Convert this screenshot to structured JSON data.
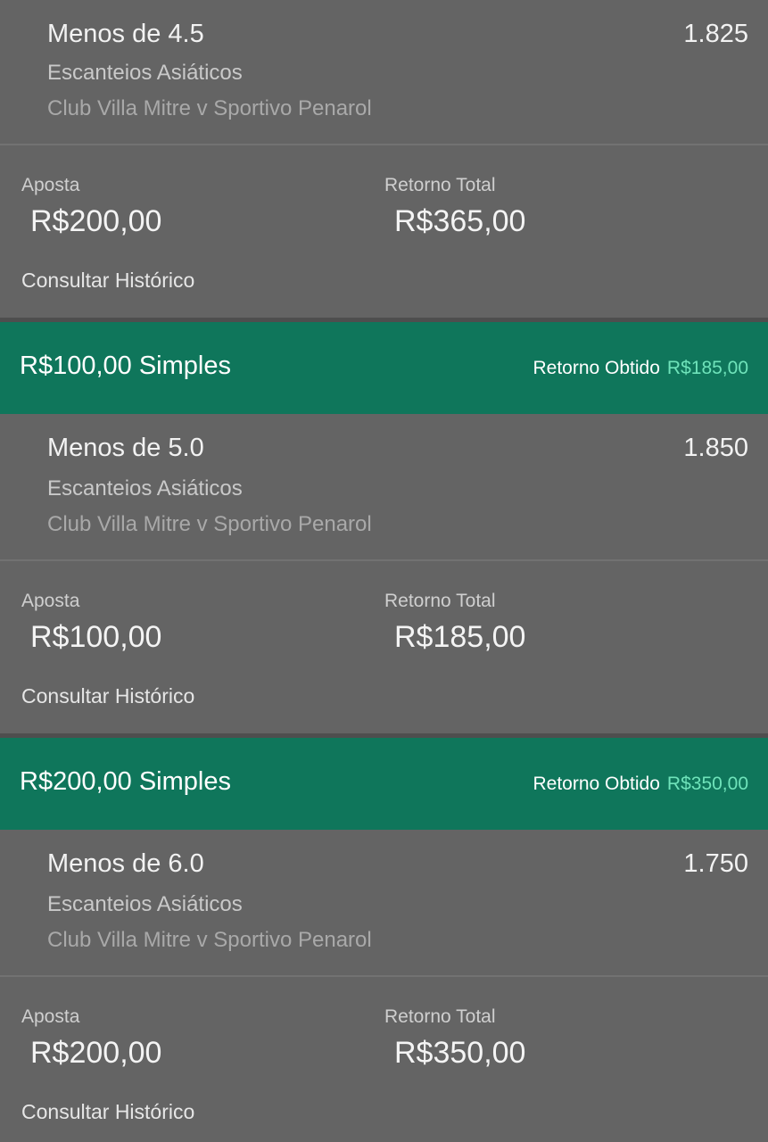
{
  "bets": [
    {
      "selection": "Menos de 4.5",
      "odds": "1.825",
      "market": "Escanteios Asiáticos",
      "event": "Club Villa Mitre v Sportivo Penarol",
      "stake_label": "Aposta",
      "stake": "R$200,00",
      "return_label": "Retorno Total",
      "return_total": "R$365,00",
      "history_link": "Consultar Histórico"
    },
    {
      "header_title": "R$100,00 Simples",
      "header_return_label": "Retorno Obtido",
      "header_return_value": "R$185,00",
      "selection": "Menos de 5.0",
      "odds": "1.850",
      "market": "Escanteios Asiáticos",
      "event": "Club Villa Mitre v Sportivo Penarol",
      "stake_label": "Aposta",
      "stake": "R$100,00",
      "return_label": "Retorno Total",
      "return_total": "R$185,00",
      "history_link": "Consultar Histórico"
    },
    {
      "header_title": "R$200,00 Simples",
      "header_return_label": "Retorno Obtido",
      "header_return_value": "R$350,00",
      "selection": "Menos de 6.0",
      "odds": "1.750",
      "market": "Escanteios Asiáticos",
      "event": "Club Villa Mitre v Sportivo Penarol",
      "stake_label": "Aposta",
      "stake": "R$200,00",
      "return_label": "Retorno Total",
      "return_total": "R$350,00",
      "history_link": "Consultar Histórico"
    }
  ],
  "colors": {
    "header_background": "#0f765b",
    "return_value_accent": "#6fe3ba",
    "panel_background": "#646464"
  }
}
